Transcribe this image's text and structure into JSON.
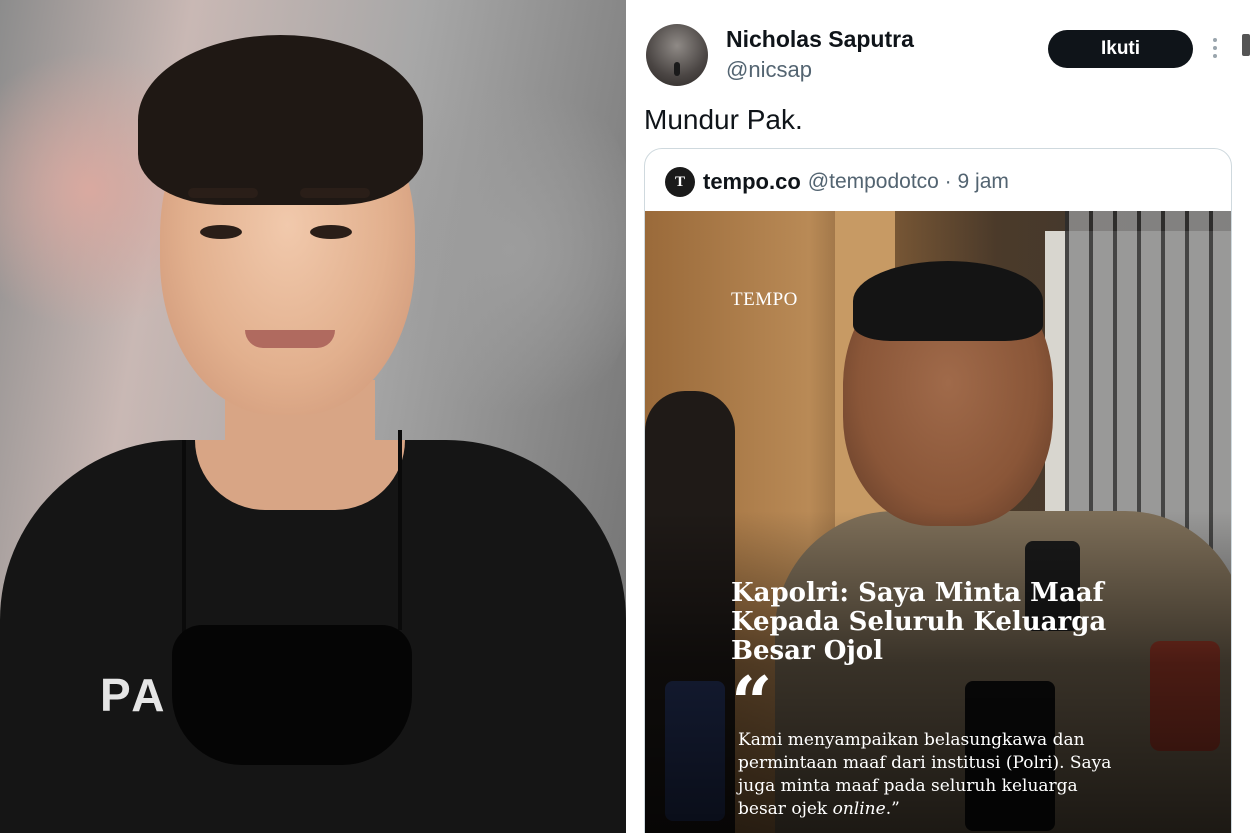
{
  "left_photo": {
    "shirt_text": "PA        A"
  },
  "tweet": {
    "author": {
      "display_name": "Nicholas Saputra",
      "handle": "@nicsap"
    },
    "follow_label": "Ikuti",
    "text": "Mundur Pak.",
    "quoted": {
      "icon_glyph": "T",
      "name": "tempo.co",
      "handle_time": "@tempodotco · 9 jam",
      "image": {
        "logo": "TEMPO",
        "headline": "Kapolri: Saya Minta Maaf Kepada Seluruh Keluarga Besar Ojol",
        "quote_mark": "“",
        "quote_text": "Kami menyampaikan belasungkawa dan permintaan maaf dari institusi (Polri). Saya juga minta maaf pada seluruh keluarga besar ojek ",
        "quote_italic": "online",
        "quote_end": ".”"
      }
    }
  },
  "icons": [
    "more-vertical-icon",
    "tempo-logo-icon"
  ],
  "colors": {
    "text_primary": "#0f1419",
    "text_secondary": "#536471",
    "follow_button": "#0f1419",
    "border": "#cfd9de"
  }
}
